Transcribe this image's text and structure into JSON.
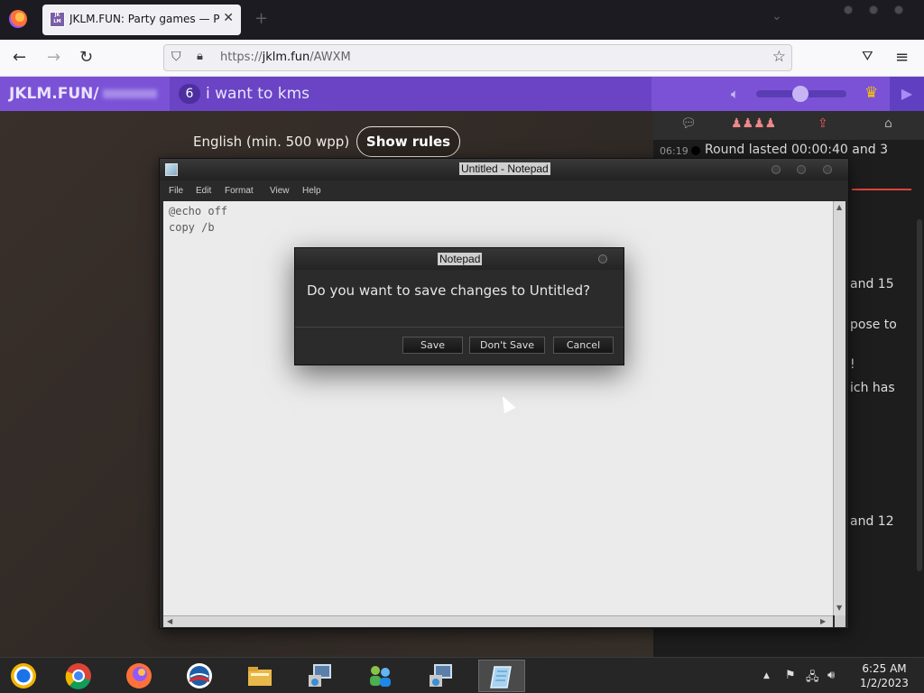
{
  "browser": {
    "tab_title": "JKLM.FUN: Party games — PC &",
    "tab_favicon_text": "JK LM",
    "url_prefix": "https://",
    "url_domain": "jklm.fun",
    "url_path": "/AWXM",
    "icons": [
      "firefox-icon",
      "close-icon",
      "new-tab-icon",
      "back-icon",
      "forward-icon",
      "reload-icon",
      "shield-icon",
      "lock-icon",
      "star-icon",
      "pocket-icon",
      "menu-icon"
    ]
  },
  "jklm": {
    "brand": "JKLM.FUN/",
    "player_count": "6",
    "room_name": "i want to kms",
    "language": "English (min. 500 wpp)",
    "rules_button": "Show rules",
    "accent": "#7b52d6"
  },
  "chat": {
    "time": "06:19",
    "first_line": "Round lasted 00:00:40 and 3",
    "fragments": [
      "and 15",
      "pose to",
      "!",
      "ich has",
      "and 12"
    ]
  },
  "notepad": {
    "title": "Untitled - Notepad",
    "menu": [
      "File",
      "Edit",
      "Format",
      "View",
      "Help"
    ],
    "content": [
      "@echo off",
      "copy /b"
    ]
  },
  "dialog": {
    "title": "Notepad",
    "message": "Do you want to save changes to Untitled?",
    "buttons": {
      "save": "Save",
      "dont_save": "Don't Save",
      "cancel": "Cancel"
    }
  },
  "taskbar": {
    "apps": [
      "chrome-canary",
      "chrome",
      "firefox",
      "obama-logo",
      "file-explorer",
      "network-installer",
      "users",
      "network-installer-2",
      "notepad"
    ],
    "clock_time": "6:25 AM",
    "clock_date": "1/2/2023"
  }
}
